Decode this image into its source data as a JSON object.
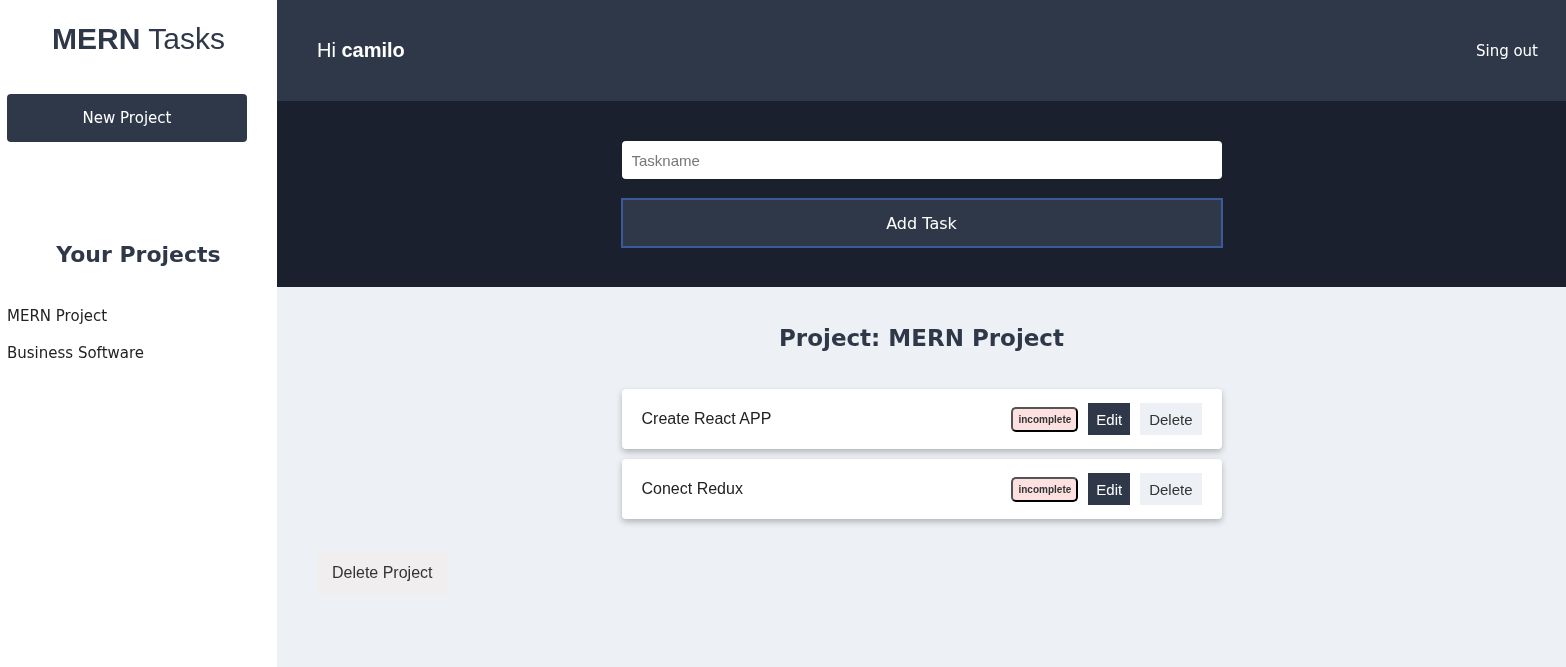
{
  "sidebar": {
    "logo": "**MERN** Tasks",
    "new_project_button": "New Project",
    "projects_heading": "Your Projects",
    "projects": [
      {
        "name": "MERN Project"
      },
      {
        "name": "Business Software"
      }
    ]
  },
  "header": {
    "greeting": "Hi **camilo**",
    "sign_out": "Sing out"
  },
  "task_form": {
    "placeholder": "Taskname",
    "submit_button": "Add Task"
  },
  "project": {
    "title": "Project: MERN Project",
    "tasks": [
      {
        "name": "Create React APP",
        "status": "incomplete",
        "complete": false,
        "edit": "Edit",
        "delete": "Delete"
      },
      {
        "name": "Conect Redux",
        "status": "incomplete",
        "complete": false,
        "edit": "Edit",
        "delete": "Delete"
      }
    ],
    "delete_project_button": "Delete Project"
  }
}
